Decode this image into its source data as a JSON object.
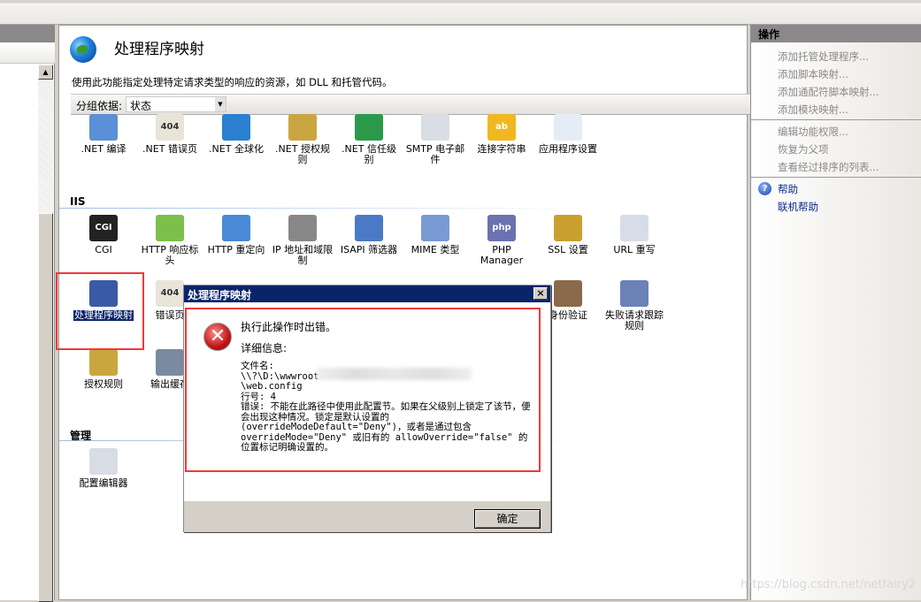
{
  "page": {
    "title": "处理程序映射",
    "description": "使用此功能指定处理特定请求类型的响应的资源，如 DLL 和托管代码。",
    "group_label": "分组依据:",
    "group_value": "状态"
  },
  "sections": {
    "iis": "IIS",
    "manage": "管理"
  },
  "features": {
    "row1": [
      {
        "label": ".NET 编译",
        "icon": "dotnet-compile-icon"
      },
      {
        "label": ".NET 错误页",
        "icon": "error-page-icon"
      },
      {
        "label": ".NET 全球化",
        "icon": "globe-icon"
      },
      {
        "label": ".NET 授权规则",
        "icon": "lock-list-icon"
      },
      {
        "label": ".NET 信任级别",
        "icon": "trust-globe-icon"
      },
      {
        "label": "SMTP 电子邮件",
        "icon": "email-icon"
      },
      {
        "label": "连接字符串",
        "icon": "database-icon"
      },
      {
        "label": "应用程序设置",
        "icon": "checklist-icon"
      }
    ],
    "row2": [
      {
        "label": "CGI",
        "icon": "cgi-icon"
      },
      {
        "label": "HTTP 响应标头",
        "icon": "http-headers-icon"
      },
      {
        "label": "HTTP 重定向",
        "icon": "redirect-icon"
      },
      {
        "label": "IP 地址和域限制",
        "icon": "ip-restrict-icon"
      },
      {
        "label": "ISAPI 筛选器",
        "icon": "filter-icon"
      },
      {
        "label": "MIME 类型",
        "icon": "mime-icon"
      },
      {
        "label": "PHP Manager",
        "icon": "php-icon"
      },
      {
        "label": "SSL 设置",
        "icon": "padlock-icon"
      },
      {
        "label": "URL 重写",
        "icon": "url-rewrite-icon"
      }
    ],
    "row3": [
      {
        "label": "处理程序映射",
        "icon": "handler-mappings-icon"
      },
      {
        "label": "错误页",
        "icon": "error-page-icon"
      },
      {
        "label": "身份验证",
        "icon": "authentication-icon"
      },
      {
        "label": "失败请求跟踪规则",
        "icon": "failed-request-icon"
      }
    ],
    "row4": [
      {
        "label": "授权规则",
        "icon": "lock-list-icon"
      },
      {
        "label": "输出缓存",
        "icon": "output-cache-icon"
      }
    ],
    "row5": [
      {
        "label": "配置编辑器",
        "icon": "config-editor-icon"
      }
    ]
  },
  "actions": {
    "header": "操作",
    "items": [
      "添加托管处理程序...",
      "添加脚本映射...",
      "添加通配符脚本映射...",
      "添加模块映射..."
    ],
    "items2": [
      "编辑功能权限...",
      "恢复为父项",
      "查看经过排序的列表..."
    ],
    "help": "帮助",
    "online_help": "联机帮助"
  },
  "dialog": {
    "title": "处理程序映射",
    "close": "×",
    "message": "执行此操作时出错。",
    "details_label": "详细信息:",
    "details": "文件名:\n\\\\?\\D:\\wwwroot                              \\web.config\n行号: 4\n错误: 不能在此路径中使用此配置节。如果在父级别上锁定了该节，便会出现这种情况。锁定是默认设置的(overrideModeDefault=\"Deny\")，或者是通过包含 overrideMode=\"Deny\" 或旧有的 allowOverride=\"false\" 的位置标记明确设置的。",
    "ok": "确定"
  },
  "watermark": "https://blog.csdn.net/netfairy2",
  "colors": {
    "titlebar": "#0a246a",
    "highlight": "#ee3b3b",
    "link": "#0b2a8a"
  }
}
